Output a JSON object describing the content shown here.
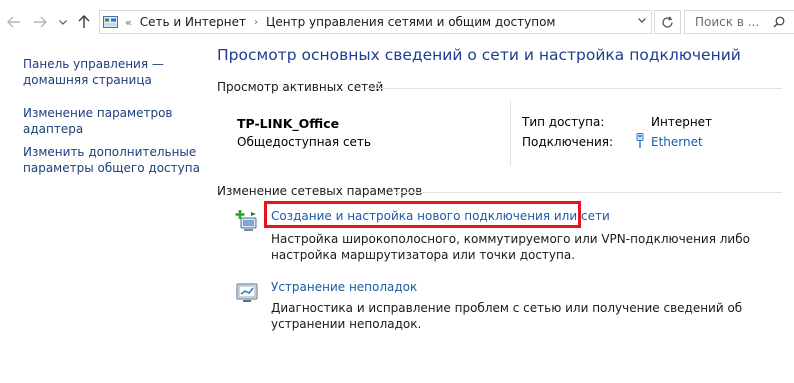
{
  "address_bar": {
    "overflow_chevron": "«",
    "path": [
      "Сеть и Интернет",
      "Центр управления сетями и общим доступом"
    ],
    "search_placeholder": "Поиск в ..."
  },
  "left_pane": {
    "links": [
      "Панель управления — домашняя страница",
      "Изменение параметров адаптера",
      "Изменить дополнительные параметры общего доступа"
    ]
  },
  "main": {
    "title": "Просмотр основных сведений о сети и настройка подключений",
    "active_networks": {
      "header": "Просмотр активных сетей",
      "network_name": "TP-LINK_Office",
      "network_category": "Общедоступная сеть",
      "access_type_label": "Тип доступа:",
      "access_type_value": "Интернет",
      "connections_label": "Подключения:",
      "connections_value": "Ethernet"
    },
    "change_settings": {
      "header": "Изменение сетевых параметров",
      "tasks": [
        {
          "link": "Создание и настройка нового подключения или сети",
          "description": "Настройка широкополосного, коммутируемого или VPN-подключения либо настройка маршрутизатора или точки доступа.",
          "icon": "new-connection-icon"
        },
        {
          "link": "Устранение неполадок",
          "description": "Диагностика и исправление проблем с сетью или получение сведений об устранении неполадок.",
          "icon": "troubleshoot-icon"
        }
      ]
    }
  },
  "colors": {
    "link": "#1c5aa6",
    "title": "#1e3d8f",
    "highlight": "#e8141d"
  }
}
